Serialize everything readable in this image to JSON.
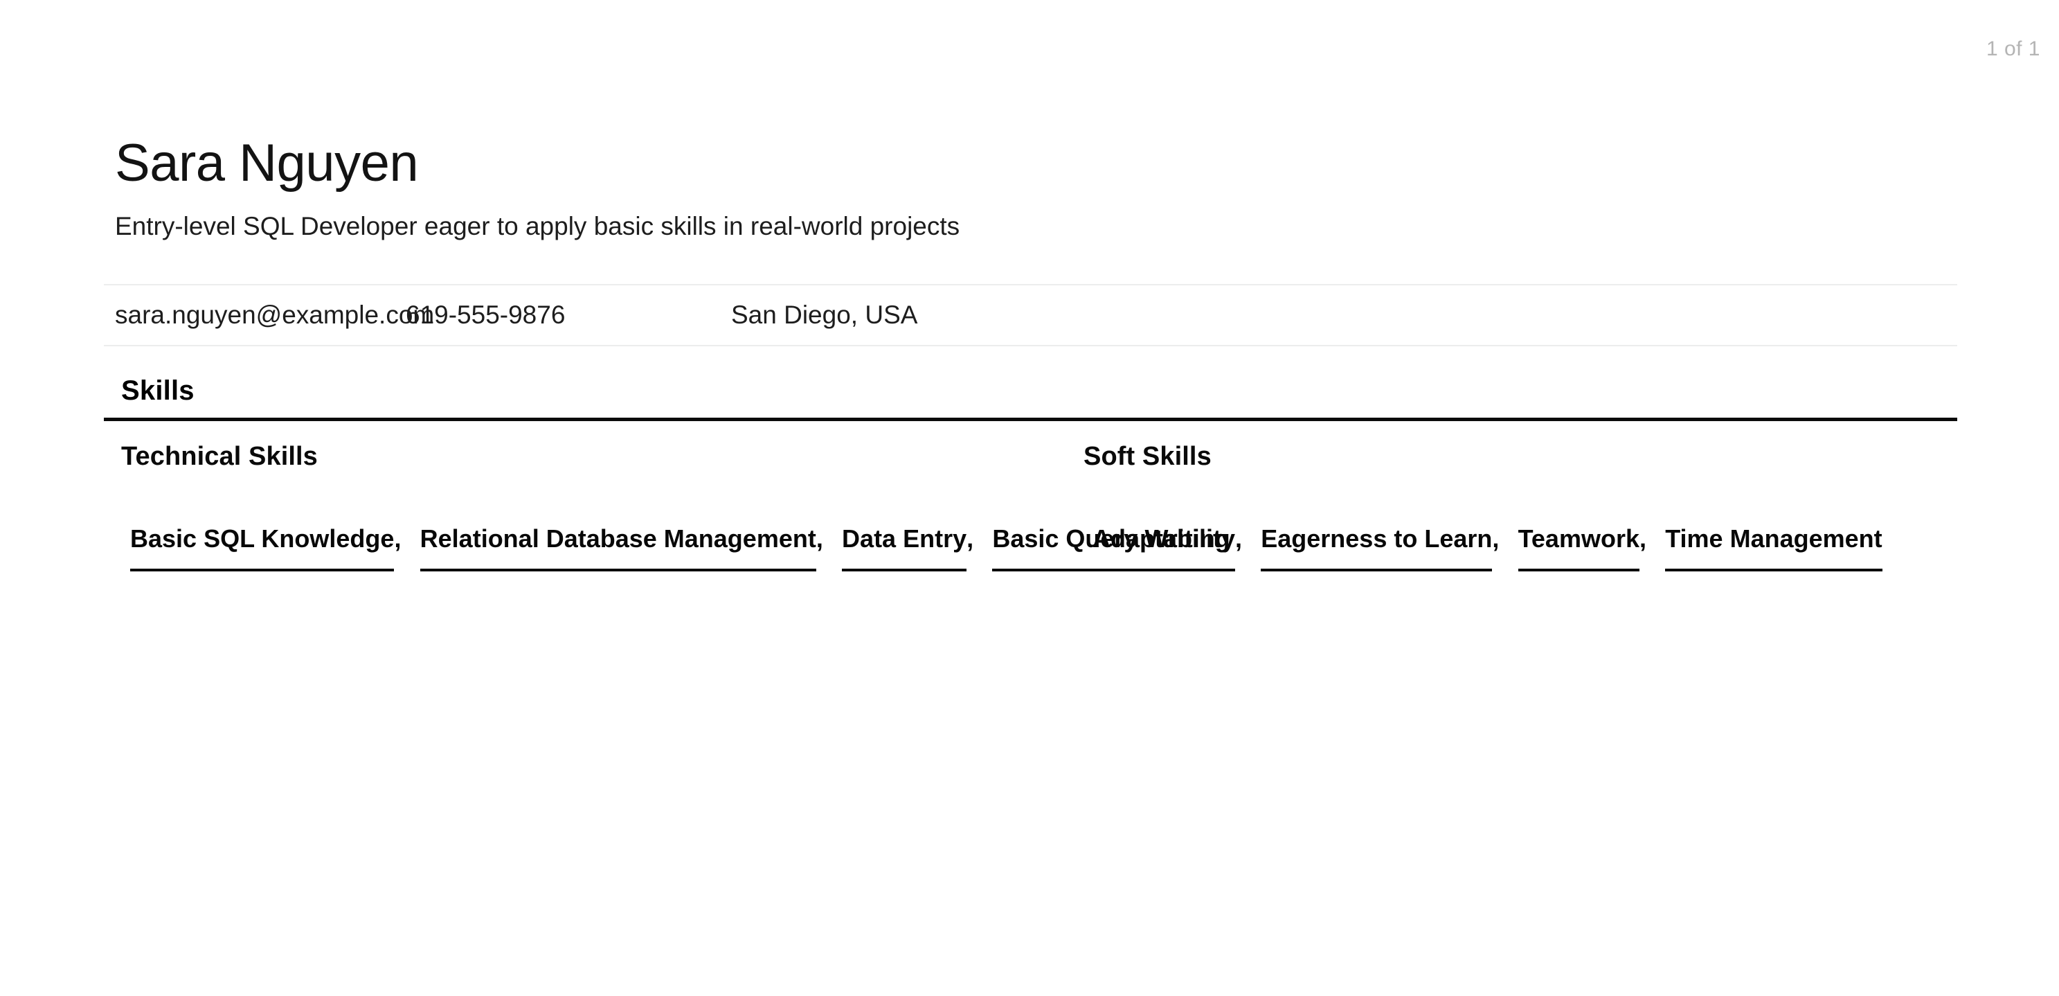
{
  "document": {
    "page_counter": "1 of 1",
    "accent_rule_color": "#0b0b0b",
    "light_rule_color": "#eceded",
    "page_counter_color": "#b4b4b4"
  },
  "header": {
    "full_name": "Sara Nguyen",
    "tagline": "Entry-level SQL Developer eager to apply basic skills in real-world projects"
  },
  "contact": {
    "email": "sara.nguyen@example.com",
    "phone": "619-555-9876",
    "location": "San Diego, USA"
  },
  "skills_section": {
    "title": "Skills",
    "groups": [
      {
        "title": "Technical Skills",
        "items": [
          "Basic SQL Knowledge",
          "Relational Database Management",
          "Data Entry",
          "Basic Query Writing"
        ]
      },
      {
        "title": "Soft Skills",
        "items": [
          "Adaptability",
          "Eagerness to Learn",
          "Teamwork",
          "Time Management"
        ]
      }
    ],
    "separator": ","
  }
}
